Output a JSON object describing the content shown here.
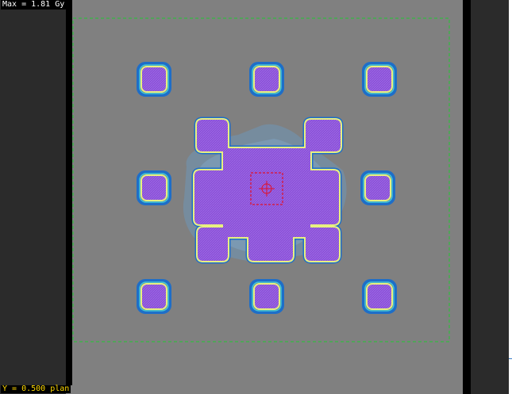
{
  "viewer": {
    "max_dose_label": "Max = 1.81 Gy",
    "slice_label": "Y = 0.500 plan"
  },
  "colors": {
    "background_dark": "#2b2b2b",
    "phantom_gray": "#808080",
    "body_outline_green": "#22c832",
    "target_box_red": "#e0102a",
    "dose_violet": "#8a4fd6",
    "isodose_yellow": "#e8f080",
    "isodose_blue": "#1e6ec8",
    "isodose_cyan": "#40c8d8",
    "low_dose_haze": "#6a9bc4"
  }
}
